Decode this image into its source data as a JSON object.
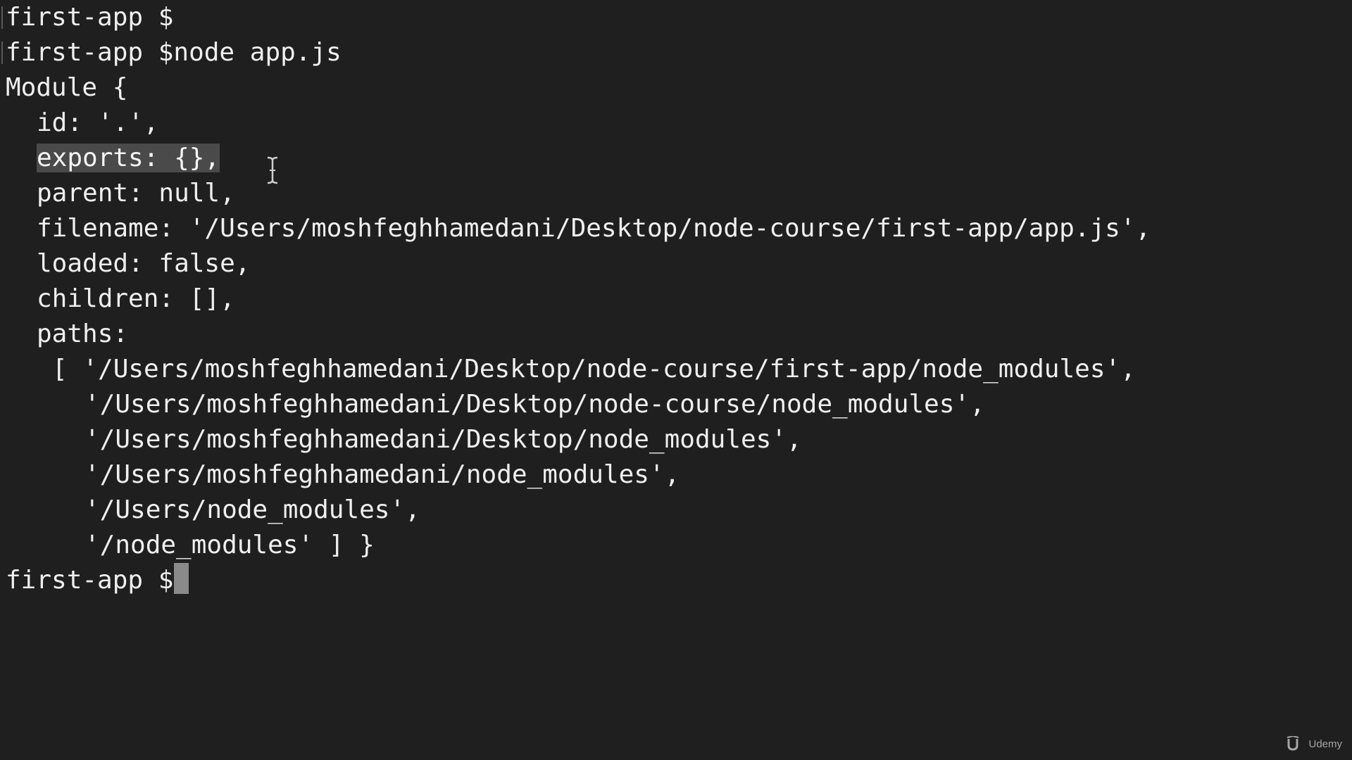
{
  "terminal": {
    "lines": [
      {
        "text": "first-app $"
      },
      {
        "text": "first-app $node app.js"
      },
      {
        "text": "Module {"
      },
      {
        "text": "id: '.',"
      },
      {
        "text": "exports: {},"
      },
      {
        "text": "parent: null,"
      },
      {
        "text": "filename: '/Users/moshfeghhamedani/Desktop/node-course/first-app/app.js',"
      },
      {
        "text": "loaded: false,"
      },
      {
        "text": "children: [],"
      },
      {
        "text": "paths:"
      },
      {
        "text": "[ '/Users/moshfeghhamedani/Desktop/node-course/first-app/node_modules',"
      },
      {
        "text": "'/Users/moshfeghhamedani/Desktop/node-course/node_modules',"
      },
      {
        "text": "'/Users/moshfeghhamedani/Desktop/node_modules',"
      },
      {
        "text": "'/Users/moshfeghhamedani/node_modules',"
      },
      {
        "text": "'/Users/node_modules',"
      },
      {
        "text": "'/node_modules' ] }"
      },
      {
        "text": "first-app $"
      }
    ]
  },
  "watermark": {
    "text": "Udemy",
    "icon": "udemy-logo-icon"
  },
  "colors": {
    "background": "#1f1f1f",
    "foreground": "#efefef",
    "selection": "#4a4a4a",
    "cursor": "#8a8a8a"
  }
}
